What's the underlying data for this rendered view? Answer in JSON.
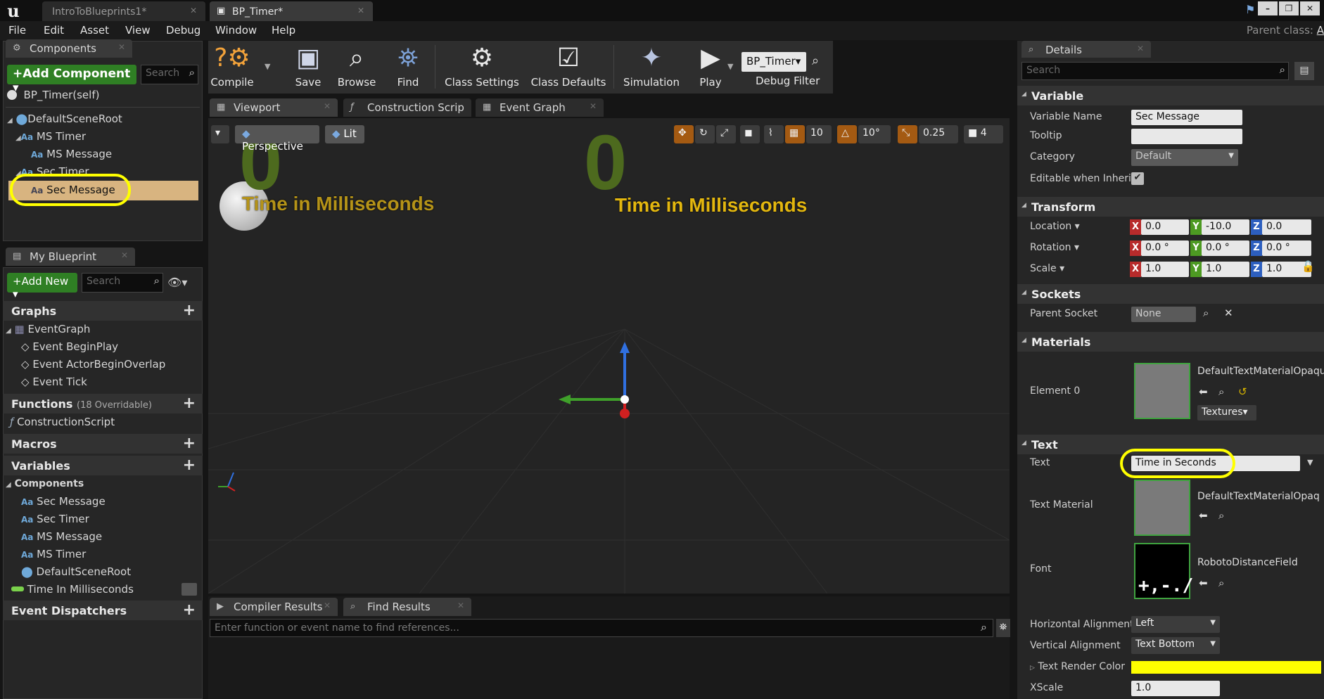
{
  "tabs": [
    {
      "label": "IntroToBlueprints1*"
    },
    {
      "label": "BP_Timer*"
    }
  ],
  "menu": [
    "File",
    "Edit",
    "Asset",
    "View",
    "Debug",
    "Window",
    "Help"
  ],
  "parent_class_label": "Parent class:",
  "parent_class_value": "A",
  "components_panel": {
    "title": "Components",
    "add_component": "+Add Component ▾",
    "search_placeholder": "Search",
    "self": "BP_Timer(self)",
    "tree": [
      "DefaultSceneRoot",
      "MS Timer",
      "MS Message",
      "Sec Timer",
      "Sec Message"
    ]
  },
  "blueprint_panel": {
    "title": "My Blueprint",
    "add_new": "+Add New ▾",
    "search_placeholder": "Search",
    "graphs_label": "Graphs",
    "event_graph": "EventGraph",
    "events": [
      "Event BeginPlay",
      "Event ActorBeginOverlap",
      "Event Tick"
    ],
    "functions_label": "Functions",
    "functions_sub": "(18 Overridable)",
    "construction_script": "ConstructionScript",
    "macros_label": "Macros",
    "variables_label": "Variables",
    "components_label": "Components",
    "variables": [
      "Sec Message",
      "Sec Timer",
      "MS Message",
      "MS Timer",
      "DefaultSceneRoot"
    ],
    "time_var": "Time In Milliseconds",
    "event_dispatchers_label": "Event Dispatchers"
  },
  "toolbar": {
    "compile": "Compile",
    "save": "Save",
    "browse": "Browse",
    "find": "Find",
    "class_settings": "Class Settings",
    "class_defaults": "Class Defaults",
    "simulation": "Simulation",
    "play": "Play",
    "debug_object": "BP_Timer▾",
    "debug_filter": "Debug Filter"
  },
  "editor_tabs": [
    "Viewport",
    "Construction Scrip",
    "Event Graph"
  ],
  "viewport": {
    "perspective": "Perspective",
    "lit": "Lit",
    "grid_snap": "10",
    "rot_snap": "10°",
    "scale_snap": "0.25",
    "cam_speed": "4",
    "digit": "0",
    "caption": "Time in Milliseconds"
  },
  "bottom_tabs": [
    "Compiler Results",
    "Find Results"
  ],
  "find_placeholder": "Enter function or event name to find references...",
  "details": {
    "title": "Details",
    "search_placeholder": "Search",
    "variable_section": "Variable",
    "variable_name_label": "Variable Name",
    "variable_name": "Sec Message",
    "tooltip_label": "Tooltip",
    "category_label": "Category",
    "category": "Default",
    "editable_label": "Editable when Inherit",
    "transform_section": "Transform",
    "location_label": "Location ▾",
    "rotation_label": "Rotation ▾",
    "scale_label": "Scale ▾",
    "location": [
      "0.0",
      "-10.0",
      "0.0"
    ],
    "rotation": [
      "0.0 °",
      "0.0 °",
      "0.0 °"
    ],
    "scale": [
      "1.0",
      "1.0",
      "1.0"
    ],
    "sockets_section": "Sockets",
    "parent_socket_label": "Parent Socket",
    "parent_socket": "None",
    "materials_section": "Materials",
    "element0_label": "Element 0",
    "material_name": "DefaultTextMaterialOpaqu",
    "textures": "Textures▾",
    "text_section": "Text",
    "text_label": "Text",
    "text_value": "Time in Seconds",
    "text_material_label": "Text Material",
    "text_material": "DefaultTextMaterialOpaq",
    "font_label": "Font",
    "font_name": "RobotoDistanceField",
    "halign_label": "Horizontal Alignment",
    "halign": "Left",
    "valign_label": "Vertical Alignment",
    "valign": "Text Bottom",
    "render_color_label": "Text Render Color",
    "xscale_label": "XScale",
    "xscale": "1.0"
  },
  "colors": {
    "accent_yellow": "#ffff00",
    "green_btn": "#2f7f24",
    "text_green": "#4d6a1e",
    "text_yellow": "#e3b70f"
  }
}
